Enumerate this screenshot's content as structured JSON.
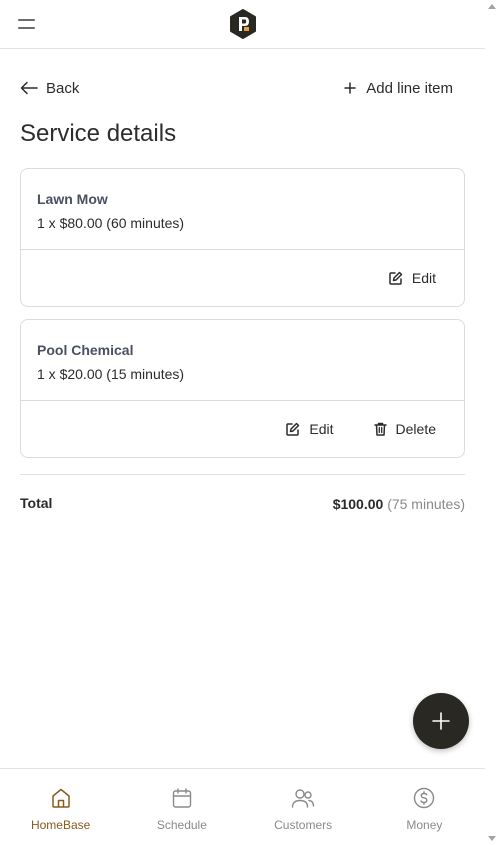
{
  "header": {
    "menu_icon": "hamburger-icon",
    "logo_icon": "brand-logo-icon"
  },
  "nav": {
    "back_label": "Back",
    "add_line_item_label": "Add line item"
  },
  "page": {
    "title": "Service details"
  },
  "line_items": [
    {
      "name": "Lawn Mow",
      "detail": "1 x $80.00 (60 minutes)",
      "actions": {
        "edit": "Edit"
      }
    },
    {
      "name": "Pool Chemical",
      "detail": "1 x $20.00 (15 minutes)",
      "actions": {
        "edit": "Edit",
        "delete": "Delete"
      }
    }
  ],
  "total": {
    "label": "Total",
    "amount": "$100.00",
    "duration": "(75 minutes)"
  },
  "fab": {
    "icon": "plus-icon"
  },
  "bottom_nav": [
    {
      "label": "HomeBase",
      "icon": "home-icon",
      "active": true
    },
    {
      "label": "Schedule",
      "icon": "calendar-icon",
      "active": false
    },
    {
      "label": "Customers",
      "icon": "users-icon",
      "active": false
    },
    {
      "label": "Money",
      "icon": "dollar-circle-icon",
      "active": false
    }
  ],
  "colors": {
    "accent": "#8a5a1e",
    "fab_bg": "#2a2823",
    "muted_text": "#8a8a8a",
    "border": "#dcdcdc"
  }
}
